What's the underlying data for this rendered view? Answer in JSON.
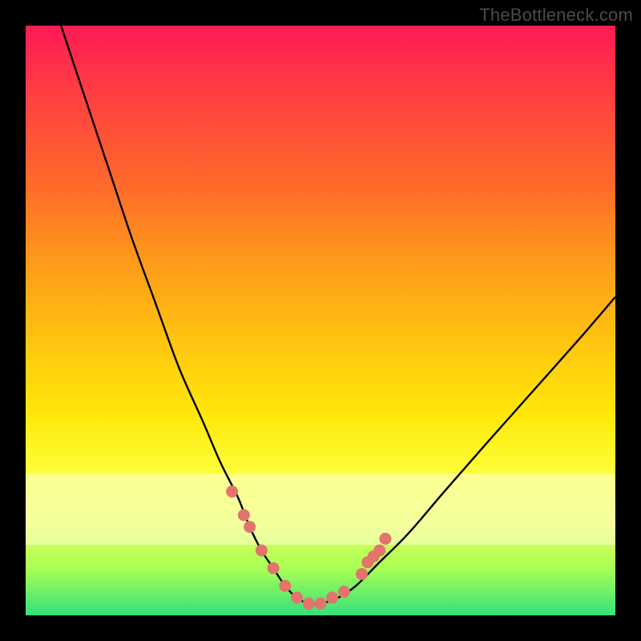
{
  "watermark": "TheBottleneck.com",
  "colors": {
    "frame": "#000000",
    "curve": "#000000",
    "marker": "#e2746d",
    "band": "rgba(255,255,210,0.55)"
  },
  "chart_data": {
    "type": "line",
    "title": "",
    "xlabel": "",
    "ylabel": "",
    "xlim": [
      0,
      100
    ],
    "ylim": [
      0,
      100
    ],
    "grid": false,
    "legend": false,
    "series": [
      {
        "name": "bottleneck-curve",
        "x": [
          6,
          10,
          14,
          18,
          22,
          26,
          30,
          33,
          36,
          38,
          40,
          42,
          44,
          46,
          48,
          50,
          53,
          56,
          60,
          65,
          71,
          78,
          86,
          94,
          100
        ],
        "y": [
          100,
          88,
          76,
          64,
          53,
          42,
          33,
          26,
          20,
          15,
          11,
          8,
          5,
          3,
          2,
          2,
          3,
          5,
          9,
          14,
          21,
          29,
          38,
          47,
          54
        ]
      }
    ],
    "markers": {
      "name": "highlight-points",
      "x": [
        35,
        37,
        38,
        40,
        42,
        44,
        46,
        48,
        50,
        52,
        54,
        57,
        58,
        59,
        60,
        61
      ],
      "y": [
        21,
        17,
        15,
        11,
        8,
        5,
        3,
        2,
        2,
        3,
        4,
        7,
        9,
        10,
        11,
        13
      ]
    },
    "band": {
      "y0": 12,
      "y1": 24
    }
  }
}
